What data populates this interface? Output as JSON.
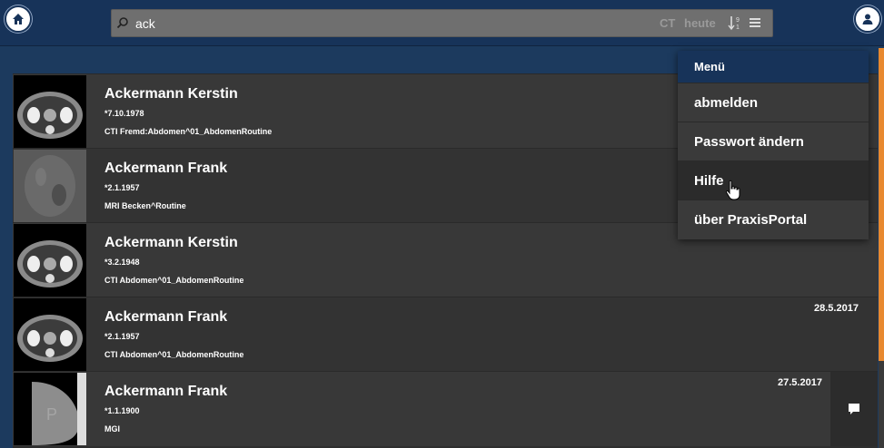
{
  "search": {
    "value": "ack",
    "placeholder": "",
    "filters": [
      "CT",
      "heute"
    ]
  },
  "menu": {
    "header": "Menü",
    "items": [
      "abmelden",
      "Passwort ändern",
      "Hilfe",
      "über PraxisPortal"
    ]
  },
  "patients": [
    {
      "name": "Ackermann Kerstin",
      "dob": "*7.10.1978",
      "study": "CTI Fremd:Abdomen^01_AbdomenRoutine",
      "date": ""
    },
    {
      "name": "Ackermann Frank",
      "dob": "*2.1.1957",
      "study": "MRI Becken^Routine",
      "date": ""
    },
    {
      "name": "Ackermann Kerstin",
      "dob": "*3.2.1948",
      "study": "CTI Abdomen^01_AbdomenRoutine",
      "date": ""
    },
    {
      "name": "Ackermann Frank",
      "dob": "*2.1.1957",
      "study": "CTI Abdomen^01_AbdomenRoutine",
      "date": "28.5.2017"
    },
    {
      "name": "Ackermann Frank",
      "dob": "*1.1.1900",
      "study": "MGI",
      "date": "27.5.2017"
    }
  ],
  "colors": {
    "accent": "#e8892f",
    "topbar": "#173359",
    "background": "#1c3a5e"
  },
  "icons": [
    "home-icon",
    "user-icon",
    "search-icon",
    "sort-icon",
    "menu-icon",
    "comment-icon"
  ]
}
